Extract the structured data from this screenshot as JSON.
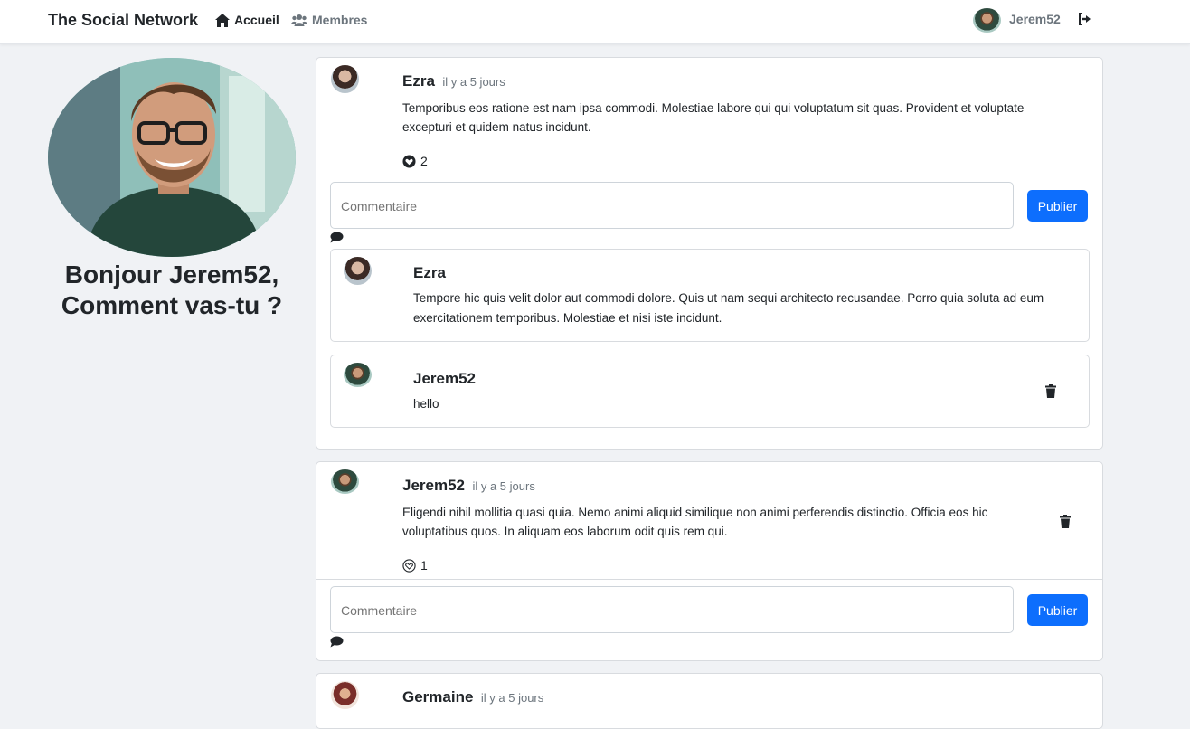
{
  "app": {
    "brand": "The Social Network",
    "nav": {
      "home": "Accueil",
      "members": "Membres"
    },
    "user": {
      "name": "Jerem52"
    }
  },
  "sidebar": {
    "greeting_line1": "Bonjour Jerem52,",
    "greeting_line2": "Comment vas-tu ?"
  },
  "posts": [
    {
      "author": "Ezra",
      "time": "il y a 5 jours",
      "text": "Temporibus eos ratione est nam ipsa commodi. Molestiae labore qui qui voluptatum sit quas. Provident et voluptate excepturi et quidem natus incidunt.",
      "likes": "2",
      "liked": true,
      "comment_placeholder": "Commentaire",
      "publish_label": "Publier",
      "comments": [
        {
          "author": "Ezra",
          "text": "Tempore hic quis velit dolor aut commodi dolore. Quis ut nam sequi architecto recusandae. Porro quia soluta ad eum exercitationem temporibus. Molestiae et nisi iste incidunt."
        },
        {
          "author": "Jerem52",
          "text": "hello"
        }
      ]
    },
    {
      "author": "Jerem52",
      "time": "il y a 5 jours",
      "text": "Eligendi nihil mollitia quasi quia. Nemo animi aliquid similique non animi perferendis distinctio. Officia eos hic voluptatibus quos. In aliquam eos laborum odit quis rem qui.",
      "likes": "1",
      "liked": false,
      "comment_placeholder": "Commentaire",
      "publish_label": "Publier"
    },
    {
      "author": "Germaine",
      "time": "il y a 5 jours"
    }
  ],
  "colors": {
    "background": "#f0f2f5",
    "primary": "#0d6efd",
    "text": "#212529",
    "muted": "#6c757d"
  },
  "icons": {
    "home": "home-icon",
    "members": "users-icon",
    "logout": "logout-icon",
    "like_filled": "heart-filled-icon",
    "like_outline": "heart-outline-icon",
    "comment": "comment-icon",
    "delete": "trash-icon"
  }
}
